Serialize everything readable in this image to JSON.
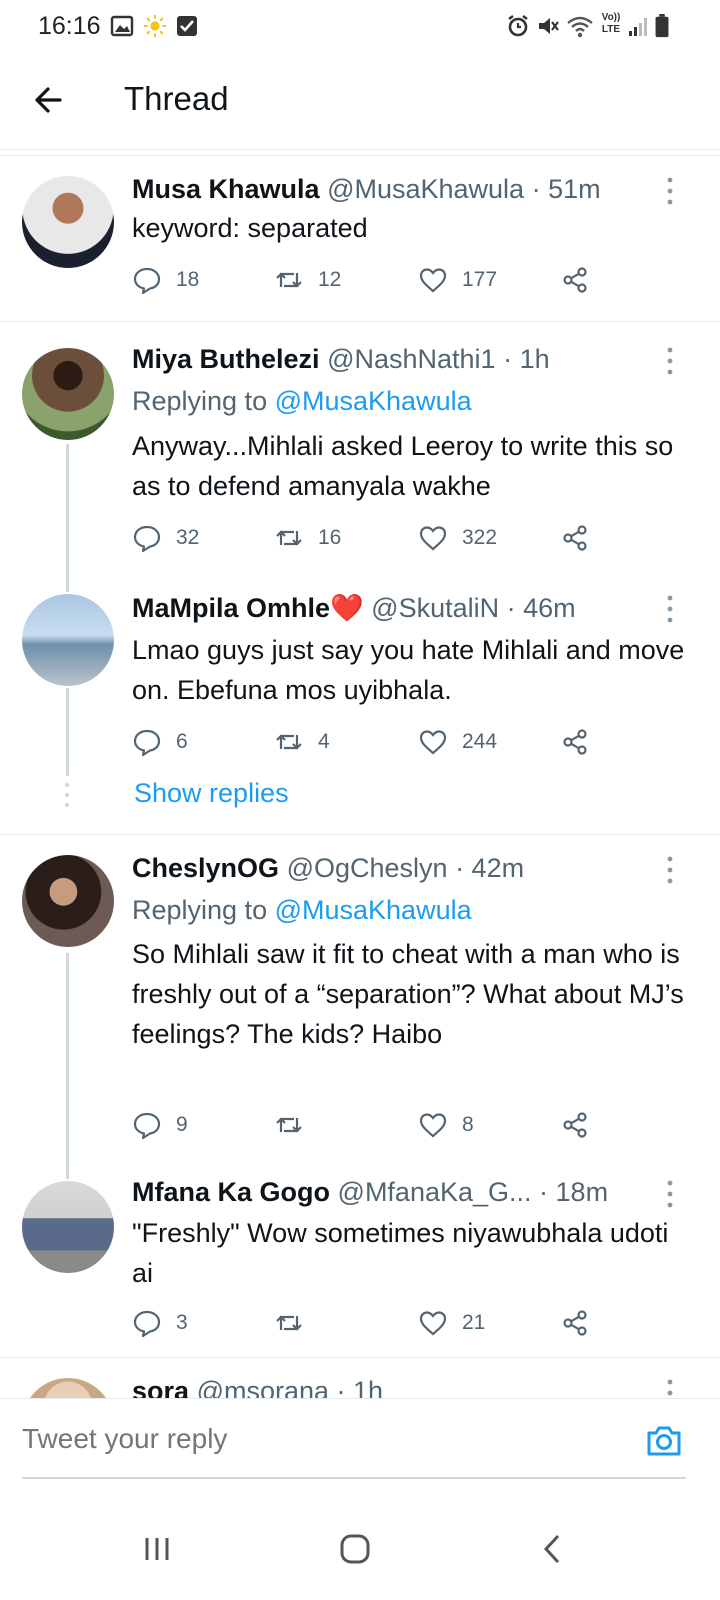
{
  "status_bar": {
    "time": "16:16",
    "network_label": "Vo)) LTE"
  },
  "header": {
    "title": "Thread"
  },
  "tweets": [
    {
      "name": "Musa Khawula",
      "handle": "@MusaKhawula",
      "time": "· 51m",
      "replying_to": "",
      "text": "keyword: separated",
      "replies": "18",
      "retweets": "12",
      "likes": "177"
    },
    {
      "name": "Miya Buthelezi",
      "handle": "@NashNathi1",
      "time": "· 1h",
      "replying_prefix": "Replying to ",
      "replying_to": "@MusaKhawula",
      "text": "Anyway...Mihlali asked Leeroy to write this so as to defend amanyala wakhe",
      "replies": "32",
      "retweets": "16",
      "likes": "322"
    },
    {
      "name": "MaMpila Omhle",
      "name_emoji": "❤️",
      "handle": "@SkutaliN",
      "time": "· 46m",
      "replying_to": "",
      "text": "Lmao guys just say you hate Mihlali and move on. Ebefuna mos uyibhala.",
      "replies": "6",
      "retweets": "4",
      "likes": "244"
    },
    {
      "name": "CheslynOG",
      "handle": "@OgCheslyn",
      "time": "· 42m",
      "replying_prefix": "Replying to ",
      "replying_to": "@MusaKhawula",
      "text": "So Mihlali saw it fit to cheat with a man who is freshly out of a “separation”? What about MJ’s feelings? The kids? Haibo",
      "replies": "9",
      "retweets": "",
      "likes": "8"
    },
    {
      "name": "Mfana Ka Gogo",
      "handle": "@MfanaKa_G...",
      "time": "· 18m",
      "replying_to": "",
      "text": "\"Freshly\" Wow sometimes niyawubhala udoti ai",
      "replies": "3",
      "retweets": "",
      "likes": "21"
    },
    {
      "name": "sora",
      "handle": "@msorana",
      "time": "· 1h"
    }
  ],
  "show_replies_label": "Show replies",
  "reply_bar": {
    "placeholder": "Tweet your reply"
  },
  "colors": {
    "accent": "#1d9bf0",
    "muted": "#536471",
    "text": "#0f1419",
    "divider": "#e6ecf0"
  }
}
